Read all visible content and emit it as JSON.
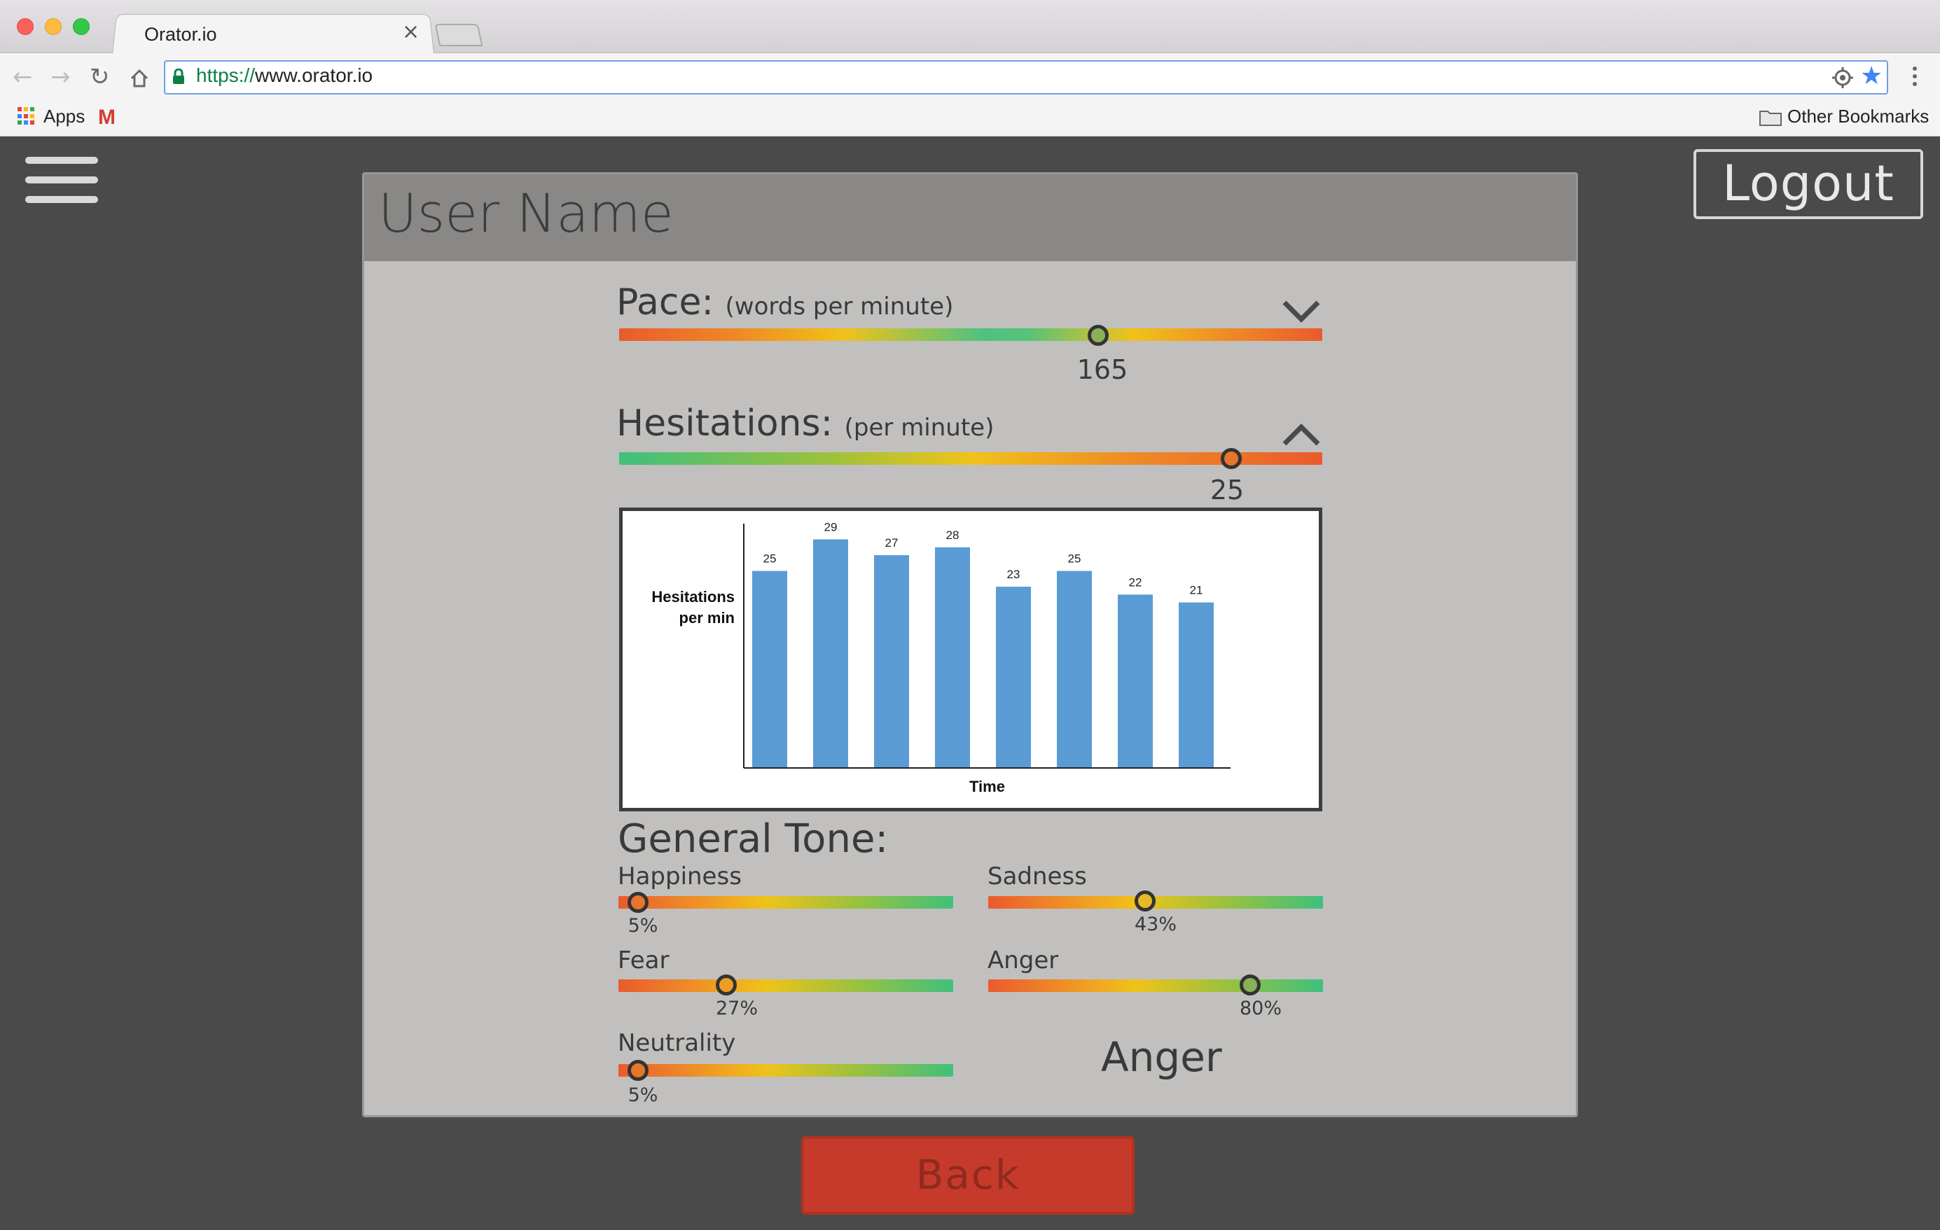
{
  "browser": {
    "tab_title": "Orator.io",
    "tab_close": "×",
    "url_scheme": "https://",
    "url_host": "www.orator.io",
    "bookmarks": {
      "apps_label": "Apps",
      "other_label": "Other Bookmarks"
    },
    "icons": [
      "back-arrow-icon",
      "forward-arrow-icon",
      "reload-icon",
      "home-icon",
      "lock-icon",
      "location-target-icon",
      "star-icon",
      "kebab-menu-icon",
      "apps-grid-icon",
      "gmail-icon",
      "folder-icon"
    ]
  },
  "app": {
    "user_name": "User Name",
    "logout_label": "Logout",
    "back_label": "Back",
    "colors": {
      "card": "#c2c0be",
      "header": "#8a8886",
      "back": "#c63a2b",
      "bars": "#5b9bd5"
    },
    "pace": {
      "title": "Pace:",
      "subtitle": "(words per minute)",
      "value": "165",
      "level": 0.68,
      "expanded": false
    },
    "hesitations": {
      "title": "Hesitations:",
      "subtitle": "(per minute)",
      "value": "25",
      "level": 0.87,
      "expanded": true
    },
    "tone": {
      "title": "General Tone:",
      "items": [
        {
          "label": "Happiness",
          "value": "5%",
          "level": 0.05
        },
        {
          "label": "Sadness",
          "value": "43%",
          "level": 0.47
        },
        {
          "label": "Fear",
          "value": "27%",
          "level": 0.32
        },
        {
          "label": "Anger",
          "value": "80%",
          "level": 0.79
        },
        {
          "label": "Neutrality",
          "value": "5%",
          "level": 0.05
        }
      ],
      "dominant": "Anger"
    }
  },
  "chart_data": {
    "type": "bar",
    "categories": [
      "",
      "",
      "",
      "",
      "",
      "",
      "",
      ""
    ],
    "values": [
      25,
      29,
      27,
      28,
      23,
      25,
      22,
      21
    ],
    "data_labels": [
      "25",
      "29",
      "27",
      "28",
      "23",
      "25",
      "22",
      "21"
    ],
    "xlabel": "Time",
    "ylabel": "Hesitations per min",
    "ylabel_lines": [
      "Hesitations",
      "per min"
    ],
    "ylim": [
      0,
      31
    ],
    "grid": false,
    "legend": "none",
    "bar_color": "#5b9bd5"
  }
}
